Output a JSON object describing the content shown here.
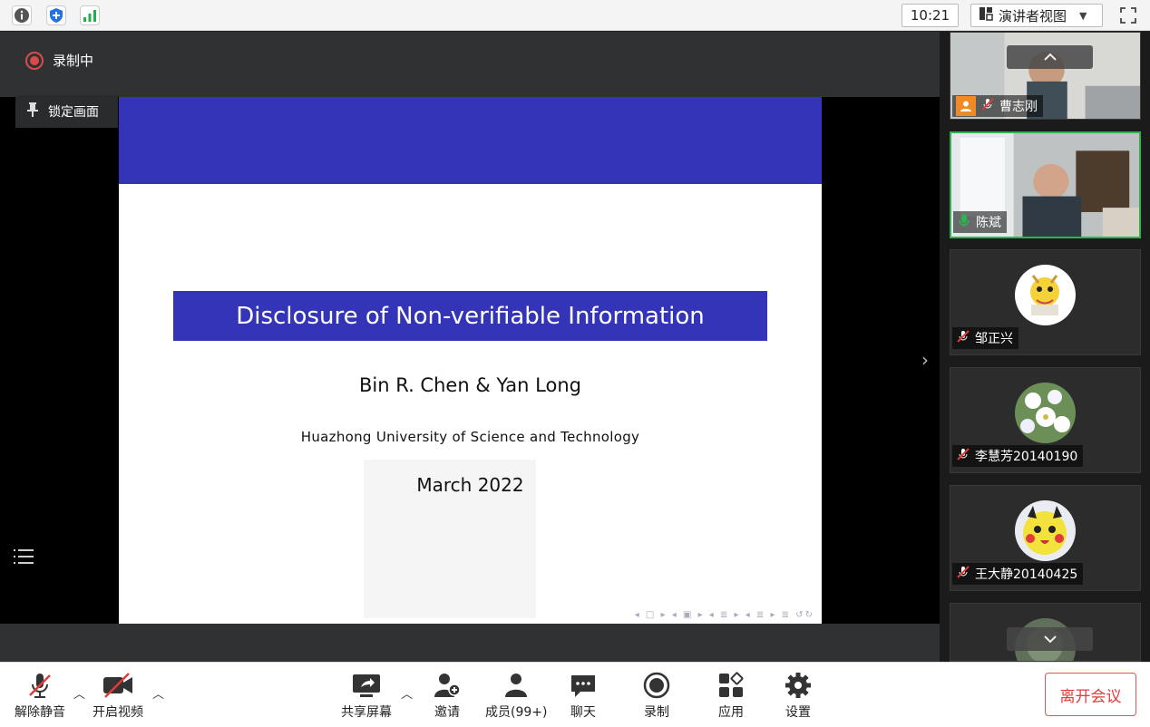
{
  "topbar": {
    "clock": "10:21",
    "view_mode": "演讲者视图",
    "icons": [
      "info-icon",
      "shield-icon",
      "signal-icon",
      "fullscreen-icon"
    ]
  },
  "recording": {
    "label": "录制中",
    "color": "#d94b4b"
  },
  "lock_screen": {
    "label": "锁定画面"
  },
  "slide": {
    "title": "Disclosure of Non-verifiable Information",
    "authors": "Bin R. Chen & Yan Long",
    "institution": "Huazhong University of Science and Technology",
    "date": "March 2022",
    "accent_color": "#3434b8"
  },
  "participants": [
    {
      "name": "曹志刚",
      "video": true,
      "mic": "muted",
      "host": true
    },
    {
      "name": "陈斌",
      "video": true,
      "mic": "speaking",
      "active": true
    },
    {
      "name": "邹正兴",
      "video": false,
      "mic": "muted"
    },
    {
      "name": "李慧芳20140190",
      "video": false,
      "mic": "muted"
    },
    {
      "name": "王大静20140425",
      "video": false,
      "mic": "muted"
    }
  ],
  "toolbar": {
    "unmute": "解除静音",
    "start_video": "开启视频",
    "share_screen": "共享屏幕",
    "invite": "邀请",
    "members": "成员(99+)",
    "chat": "聊天",
    "record": "录制",
    "apps": "应用",
    "settings": "设置",
    "leave": "离开会议"
  },
  "colors": {
    "leave": "#e23b3b",
    "speaking": "#2fb24f"
  }
}
